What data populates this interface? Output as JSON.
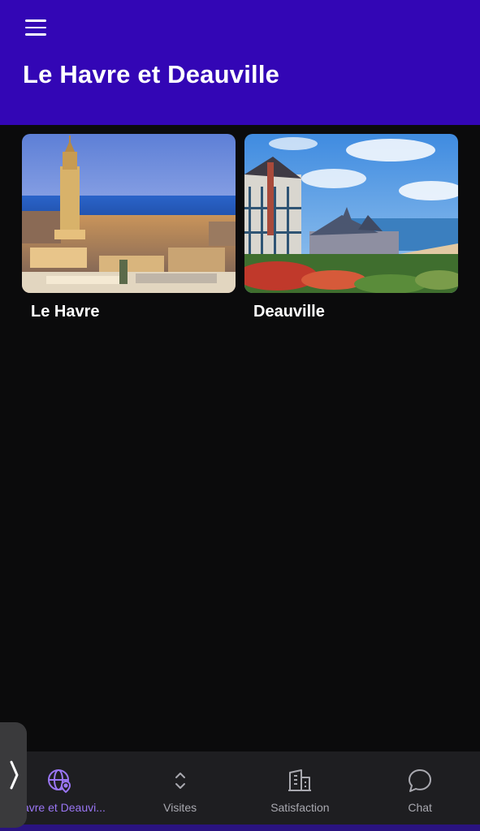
{
  "header": {
    "title": "Le Havre et Deauville",
    "menu_icon": "hamburger-menu-icon"
  },
  "cards": [
    {
      "label": "Le Havre",
      "image": "le-havre-city-photo"
    },
    {
      "label": "Deauville",
      "image": "deauville-seaside-photo"
    }
  ],
  "bottom_nav": {
    "items": [
      {
        "label": "Havre et Deauvi...",
        "icon": "globe-location-icon",
        "active": true
      },
      {
        "label": "Visites",
        "icon": "chevrons-up-down-icon",
        "active": false
      },
      {
        "label": "Satisfaction",
        "icon": "building-icon",
        "active": false
      },
      {
        "label": "Chat",
        "icon": "chat-bubble-icon",
        "active": false
      }
    ]
  },
  "side_handle": {
    "icon": "chevron-right-icon"
  },
  "colors": {
    "header_bg": "#3306b5",
    "background": "#0b0b0c",
    "nav_bg": "#1e1e21",
    "active": "#9a76f4",
    "inactive": "#a9a9b0"
  }
}
